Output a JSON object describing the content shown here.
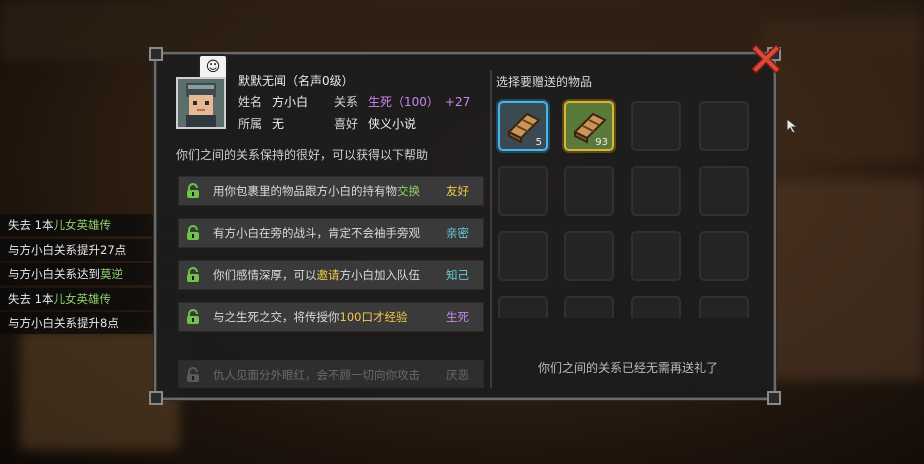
{
  "log": [
    {
      "prefix": "失去 1本",
      "highlight": "儿女英雄传",
      "suffix": ""
    },
    {
      "prefix": "与方小白关系提升27点",
      "highlight": "",
      "suffix": ""
    },
    {
      "prefix": "与方小白关系达到",
      "highlight": "莫逆",
      "suffix": ""
    },
    {
      "prefix": "失去 1本",
      "highlight": "儿女英雄传",
      "suffix": ""
    },
    {
      "prefix": "与方小白关系提升8点",
      "highlight": "",
      "suffix": ""
    }
  ],
  "character": {
    "title": "默默无闻（名声0级）",
    "name_label": "姓名",
    "name_value": "方小白",
    "relation_label": "关系",
    "relation_value": "生死（100）",
    "relation_change": "+27",
    "faction_label": "所属",
    "faction_value": "无",
    "hobby_label": "喜好",
    "hobby_value": "侠义小说"
  },
  "help_text": "你们之间的关系保持的很好，可以获得以下帮助",
  "help_rows": [
    {
      "parts": [
        {
          "t": "用你包裹里的物品跟方小白的持有物"
        },
        {
          "t": "交换",
          "c": "green"
        }
      ],
      "level": "友好",
      "level_color": "yellow"
    },
    {
      "parts": [
        {
          "t": "有方小白在旁的战斗，肯定不会袖手旁观"
        }
      ],
      "level": "亲密",
      "level_color": "teal"
    },
    {
      "parts": [
        {
          "t": "你们感情深厚，可以"
        },
        {
          "t": "邀请",
          "c": "yellow"
        },
        {
          "t": "方小白加入队伍"
        }
      ],
      "level": "知己",
      "level_color": "teal"
    },
    {
      "parts": [
        {
          "t": "与之生死之交，将传授你"
        },
        {
          "t": "100口才经验",
          "c": "yellow"
        }
      ],
      "level": "生死",
      "level_color": "purple"
    },
    {
      "parts": [
        {
          "t": "仇人见面分外眼红，会不顾一切向你攻击"
        }
      ],
      "level": "厌恶",
      "level_color": "gray"
    }
  ],
  "gift": {
    "title": "选择要赠送的物品",
    "items": [
      {
        "name": "book-item",
        "count": "5"
      },
      {
        "name": "book-item",
        "count": "93"
      }
    ],
    "empty_message": "你们之间的关系已经无需再送礼了"
  },
  "icons": {
    "close": "close-x-icon",
    "lock": "lock-icon",
    "emote": "speech-face-icon",
    "cursor": "arrow-cursor-icon"
  },
  "colors": {
    "purple": "#c586f0",
    "green": "#8fd16a",
    "yellow": "#f2c84b",
    "teal": "#6ac9d6",
    "close_red": "#d84a3a"
  }
}
